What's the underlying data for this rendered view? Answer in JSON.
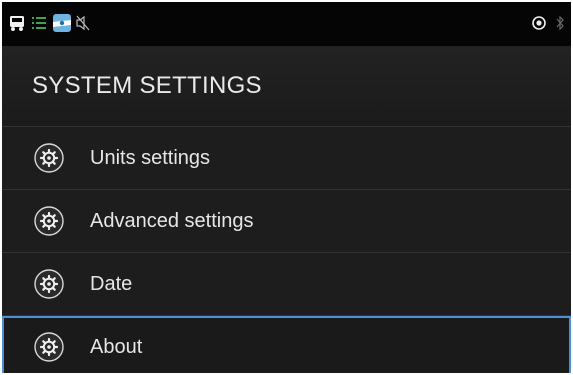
{
  "status_bar": {
    "left_icons": [
      "truck-icon",
      "list-icon",
      "map-tile-icon",
      "speaker-muted-icon"
    ],
    "right_icons": [
      "gps-target-icon",
      "bluetooth-icon"
    ]
  },
  "header": {
    "title": "SYSTEM SETTINGS"
  },
  "menu": {
    "items": [
      {
        "label": "Units settings",
        "icon": "gear-icon"
      },
      {
        "label": "Advanced settings",
        "icon": "gear-icon"
      },
      {
        "label": "Date",
        "icon": "gear-icon"
      },
      {
        "label": "About",
        "icon": "gear-icon",
        "selected": true
      }
    ]
  },
  "colors": {
    "background": "#1f1f1f",
    "selection": "#4a90d9",
    "text": "#e6e6e6"
  }
}
